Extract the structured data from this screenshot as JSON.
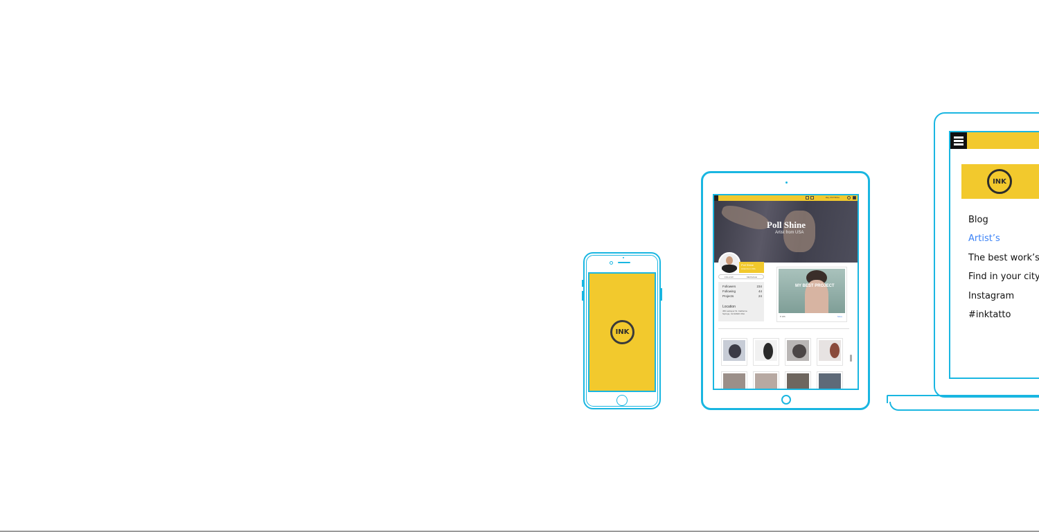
{
  "colors": {
    "accent": "#19b6e1",
    "brand_yellow": "#f2c92d",
    "link_active": "#3b82f6"
  },
  "phone": {
    "logo_text": "INK"
  },
  "tablet": {
    "topbar": {
      "user": "Hey, Poll Shine"
    },
    "hero": {
      "name": "Poll Shine",
      "subtitle": "Artist from USA"
    },
    "profile": {
      "name": "Poll Shine",
      "role": "Artist from USA",
      "follow": "FOLLOW",
      "message": "MESSAGE"
    },
    "stats": [
      {
        "label": "Followers",
        "value": "234"
      },
      {
        "label": "Following",
        "value": "44"
      },
      {
        "label": "Projects",
        "value": "24"
      }
    ],
    "location": {
      "title": "Location",
      "detail": "456 Larkspur St. California Springs, CA 92926 USA"
    },
    "featured": {
      "caption": "MY BEST PROJECT",
      "likes": "♥ 186",
      "more": "More"
    }
  },
  "laptop": {
    "logo_text": "INK",
    "menu": [
      "Blog",
      "Artist’s",
      "The best work’s",
      "Find in your city",
      "Instagram",
      "#inktatto"
    ],
    "active_item": "Artist’s"
  }
}
